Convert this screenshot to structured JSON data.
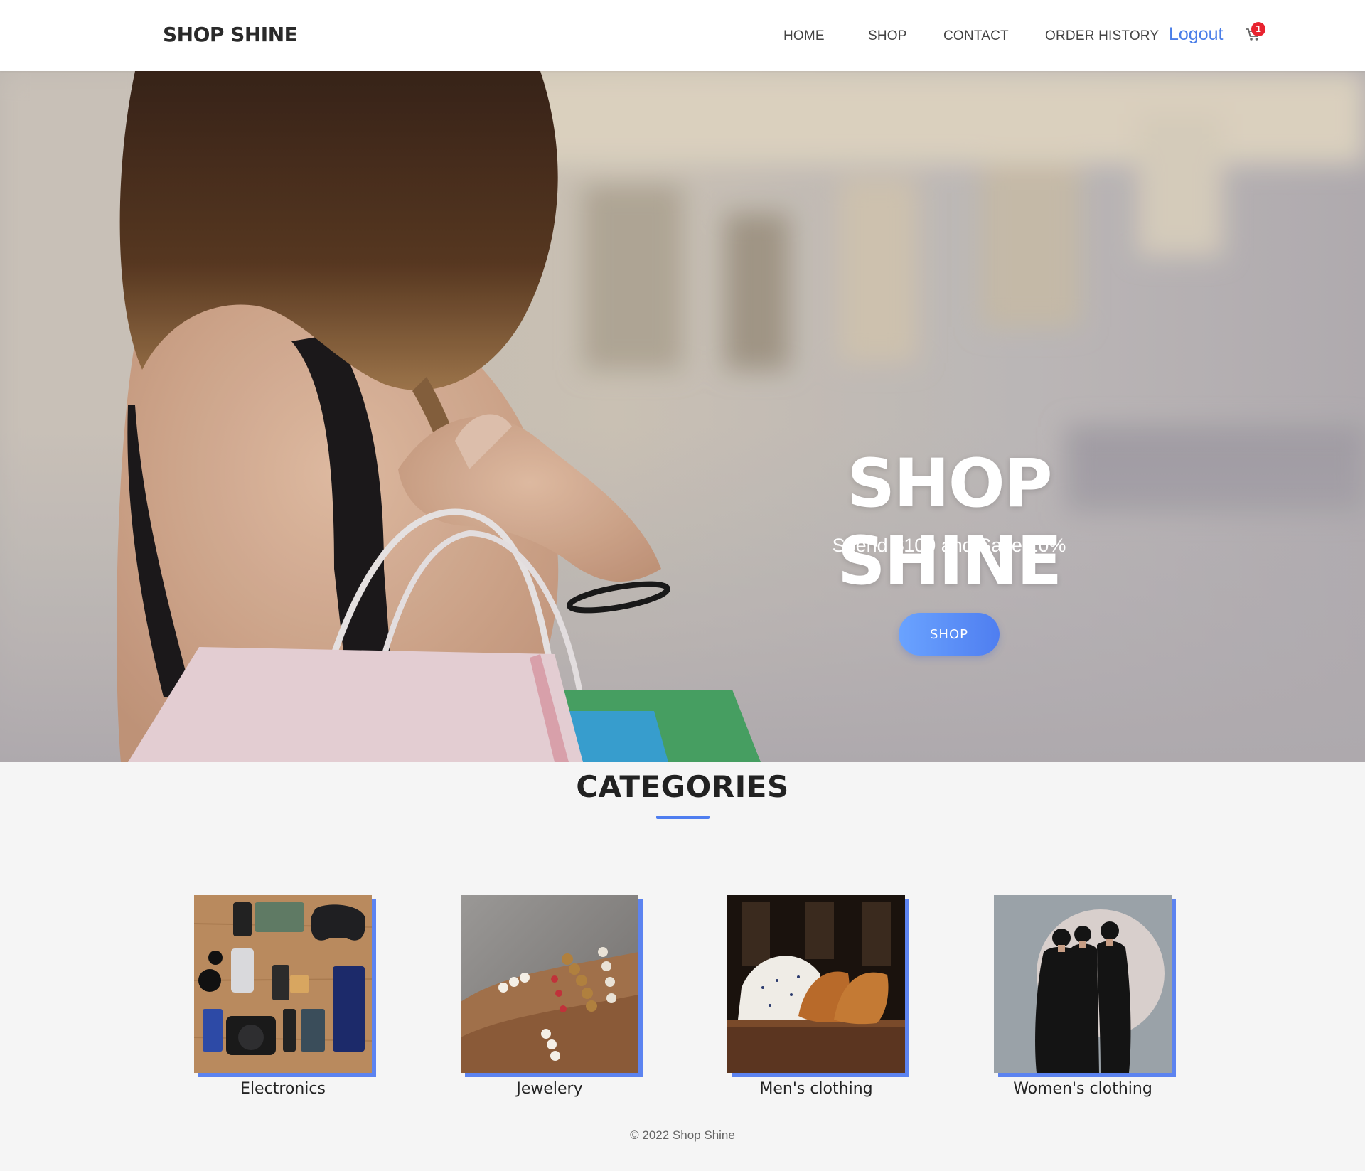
{
  "brand": "SHOP SHINE",
  "nav": {
    "home": "HOME",
    "shop": "SHOP",
    "contact": "CONTACT",
    "order_history": "ORDER HISTORY",
    "logout": "Logout",
    "cart_count": "1"
  },
  "hero": {
    "title": "SHOP SHINE",
    "subtitle": "Spend $100 and Save 10%",
    "button": "SHOP"
  },
  "categories": {
    "heading": "CATEGORIES",
    "items": [
      {
        "label": "Electronics"
      },
      {
        "label": "Jewelery"
      },
      {
        "label": "Men's clothing"
      },
      {
        "label": "Women's clothing"
      }
    ]
  },
  "footer": "© 2022 Shop Shine",
  "colors": {
    "accent": "#4f7ef0",
    "logout": "#4a7ee8",
    "badge": "#e8232f"
  },
  "icons": {
    "cart": "cart-icon"
  }
}
